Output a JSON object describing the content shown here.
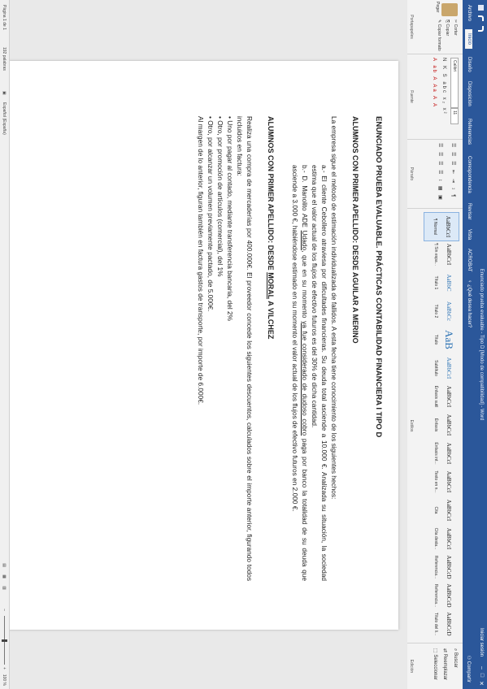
{
  "window": {
    "title": "Enunciado prueba evaluable - Tipo D [Modo de compatibilidad] - Word",
    "sign_in": "Iniciar sesión",
    "share": "Compartir",
    "tell_me": "¿Qué desea hacer?"
  },
  "tabs": [
    "Archivo",
    "Inicio",
    "Diseño",
    "Disposición",
    "Referencias",
    "Correspondencia",
    "Revisar",
    "Vista",
    "ACROBAT"
  ],
  "ribbon": {
    "clipboard": {
      "paste": "Pegar",
      "cut": "Cortar",
      "copy": "Copiar",
      "format_painter": "Copiar formato",
      "label": "Portapapeles"
    },
    "font": {
      "family": "Calibri",
      "size": "11",
      "label": "Fuente",
      "row1": "N  K  S  abc  x₂  x²",
      "row2": "A  ab  A  Aa  A  A"
    },
    "paragraph": {
      "label": "Párrafo",
      "row1": "☰  ☰  ☰  ⇤  ⇥  ↕  ¶",
      "row2": "☰  ☰  ☰  ☰  ↕  ▦  ▣"
    },
    "styles": {
      "label": "Estilos",
      "items": [
        {
          "sample": "AaBbCcI",
          "name": "¶ Normal"
        },
        {
          "sample": "AaBbCcI",
          "name": "¶ Sin espa..."
        },
        {
          "sample": "AaBbC",
          "name": "Título 1"
        },
        {
          "sample": "AaBbCc",
          "name": "Título 2"
        },
        {
          "sample": "AaB",
          "name": "Título"
        },
        {
          "sample": "AaBbCcI",
          "name": "Subtítulo"
        },
        {
          "sample": "AaBbCcI",
          "name": "Énfasis sutil"
        },
        {
          "sample": "AaBbCcI",
          "name": "Énfasis"
        },
        {
          "sample": "AaBbCcI",
          "name": "Énfasis int..."
        },
        {
          "sample": "AaBbCcI",
          "name": "Texto en n..."
        },
        {
          "sample": "AaBbCcI",
          "name": "Cita"
        },
        {
          "sample": "AaBbCcI",
          "name": "Cita desta..."
        },
        {
          "sample": "AaBbCcD",
          "name": "Referencia..."
        },
        {
          "sample": "AaBbCcD",
          "name": "Referencia..."
        },
        {
          "sample": "AaBbCcD",
          "name": "Título del li..."
        }
      ]
    },
    "editing": {
      "label": "Edición",
      "find": "Buscar",
      "replace": "Reemplazar",
      "select": "Seleccionar"
    }
  },
  "document": {
    "title": "ENUNCIADO PRUEBA EVALUABLE.   PRÁCTICAS CONTABILIDAD FINANCIERA I   TIPO D",
    "section1": {
      "heading": "ALUMNOS CON PRIMER APELLIDO: DESDE AGUILAR A MERINO",
      "p1": "La empresa sigue el método de estimación individualizada de fallidos. A esta fecha tiene conocimiento de los siguientes hechos:",
      "p2": "a.- El cliente Cebollero atraviesa por dificultades financieras. Su deuda total asciende a 10.000 €. Analizada su situación, la sociedad estima que el valor actual de los flujos de efectivo futuros es del 30% de dicha cantidad.",
      "p3_pre": "b.- D. Manolito ADE ",
      "p3_u1": "Udado",
      "p3_mid": ", que en su momento ",
      "p3_u2": "ya fue considerado de dudoso cobro",
      "p3_post": " paga por banco la totalidad de su deuda que asciende a 3.000 €, habiéndose estimado en su momento el valor actual de los flujos de efectivo futuros en 2.000 €."
    },
    "section2": {
      "heading_pre": "ALUMNOS CON PRIMER APELLIDO: DESDE ",
      "heading_u": "MORAL",
      "heading_post": " A VILCHEZ",
      "p1": "Realiza una compra de mercaderías por 400.000€. El proveedor concede los siguientes descuentos, calculados sobre el importe anterior, figurando todos incluidos en factura:",
      "b1": "• Uno por pagar al contado, mediante transferencia bancaria, del 2%",
      "b2": "• Otro, por promoción de artículos (comercial), del 1%",
      "b3": "• Otro, por alcanzar un volumen previamente pactado, de 5.000€.",
      "p2": "Al margen de lo anterior, figuran también en factura gastos de transporte, por importe de 6.000€."
    }
  },
  "status": {
    "page": "Página 1 de 1",
    "words": "192 palabras",
    "language": "Español (España)",
    "zoom": "100 %"
  }
}
